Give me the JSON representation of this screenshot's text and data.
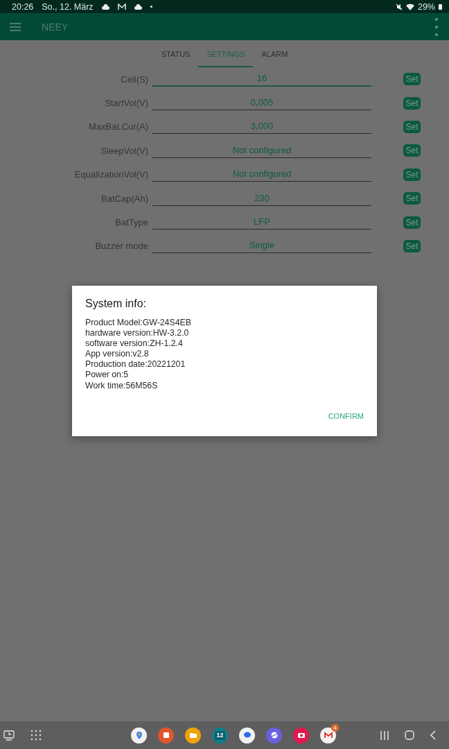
{
  "status_bar": {
    "time": "20:26",
    "date": "So., 12. März",
    "battery": "29%"
  },
  "app_bar": {
    "title": "NEEY"
  },
  "tabs": [
    {
      "label": "STATUS",
      "selected": false
    },
    {
      "label": "SETTINGS",
      "selected": true
    },
    {
      "label": "ALARM",
      "selected": false
    }
  ],
  "settings": [
    {
      "label": "Cell(S)",
      "value": "16",
      "focused": true,
      "button": "Set"
    },
    {
      "label": "StartVol(V)",
      "value": "0,005",
      "focused": false,
      "button": "Set"
    },
    {
      "label": "MaxBaLCur(A)",
      "value": "3,000",
      "focused": false,
      "button": "Set"
    },
    {
      "label": "SleepVol(V)",
      "value": "Not configured",
      "focused": false,
      "button": "Set"
    },
    {
      "label": "EqualizationVol(V)",
      "value": "Not configured",
      "focused": false,
      "button": "Set"
    },
    {
      "label": "BatCap(Ah)",
      "value": "230",
      "focused": false,
      "button": "Set"
    },
    {
      "label": "BatType",
      "value": "LFP",
      "focused": false,
      "button": "Set"
    },
    {
      "label": "Buzzer mode",
      "value": "Single",
      "focused": false,
      "button": "Set"
    }
  ],
  "dialog": {
    "title": "System info:",
    "lines": [
      "Product Model:GW-24S4EB",
      "hardware version:HW-3.2.0",
      "software version:ZH-1.2.4",
      "App version:v2.8",
      "Production date:20221201",
      "Power on:5",
      "Work time:56M56S"
    ],
    "button": "CONFIRM"
  },
  "taskbar": {
    "apps": [
      {
        "kind": "maps",
        "color": "#f2f2f2"
      },
      {
        "kind": "notes",
        "color": "#e0552b"
      },
      {
        "kind": "folder",
        "color": "#f0a20a"
      },
      {
        "kind": "calendar",
        "color": "#0e7e8f",
        "text": "12"
      },
      {
        "kind": "chat",
        "color": "#f2f2f2"
      },
      {
        "kind": "browser",
        "color": "#6b5ee0"
      },
      {
        "kind": "camera",
        "color": "#e0184e"
      },
      {
        "kind": "mail",
        "color": "#f2f2f2",
        "badge": "4"
      }
    ]
  }
}
